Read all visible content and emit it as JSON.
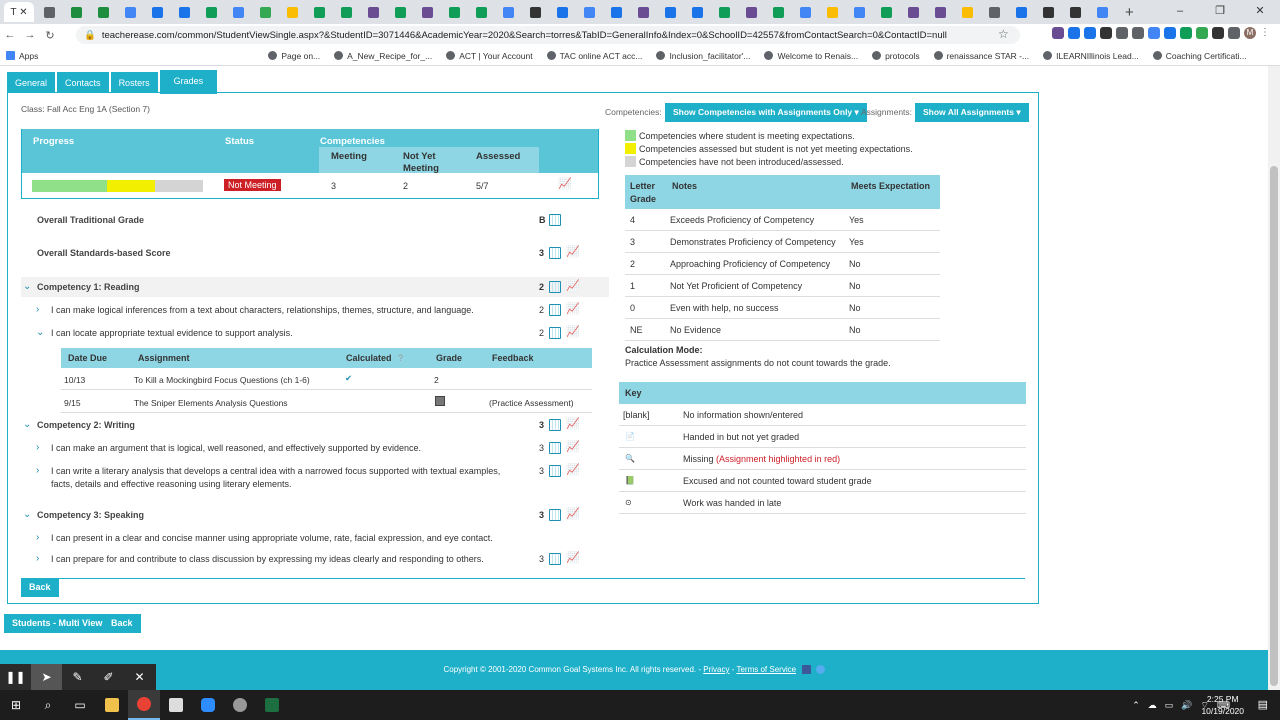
{
  "browser": {
    "active_tab_label": "T",
    "tab_icon_colors": [
      "#5f6368",
      "#1e8e3e",
      "#1e8e3e",
      "#4285f4",
      "#1a73e8",
      "#1a73e8",
      "#0f9d58",
      "#4285f4",
      "#34a853",
      "#fbbc04",
      "#0f9d58",
      "#0f9d58",
      "#6a4c93",
      "#0f9d58",
      "#6a4c93",
      "#0f9d58",
      "#0f9d58",
      "#4285f4",
      "#333",
      "#1a73e8",
      "#4285f4",
      "#1a73e8",
      "#6a4c93",
      "#1a73e8",
      "#1a73e8",
      "#0f9d58",
      "#6a4c93",
      "#0f9d58",
      "#4285f4",
      "#fbbc04",
      "#4285f4",
      "#0f9d58",
      "#6a4c93",
      "#6a4c93",
      "#fbbc04",
      "#5f6368",
      "#1a73e8",
      "#333",
      "#333",
      "#4285f4"
    ],
    "new_tab": "+",
    "window_controls": [
      "–",
      "❐",
      "✕"
    ],
    "url": "teacherease.com/common/StudentViewSingle.aspx?&StudentID=3071446&AcademicYear=2020&Search=torres&TabID=GeneralInfo&Index=0&SchoolID=42557&fromContactSearch=0&ContactID=null",
    "bookmarks": [
      {
        "label": "Apps",
        "blur": false
      },
      {
        "label": "Page on...",
        "blur": false
      },
      {
        "label": "A_New_Recipe_for_...",
        "blur": false
      },
      {
        "label": "ACT | Your Account",
        "blur": false
      },
      {
        "label": "TAC online ACT acc...",
        "blur": false
      },
      {
        "label": "Inclusion_facilitator'...",
        "blur": false
      },
      {
        "label": "Welcome to Renais...",
        "blur": false
      },
      {
        "label": "protocols",
        "blur": false
      },
      {
        "label": "renaissance STAR -...",
        "blur": false
      },
      {
        "label": "ILEARNIllinois Lead...",
        "blur": false
      },
      {
        "label": "Coaching Certificati...",
        "blur": false
      }
    ],
    "profile_initial": "M"
  },
  "tabs": [
    "General",
    "Contacts",
    "Rosters",
    "Grades"
  ],
  "class_label": "Class: Fall Acc Eng 1A (Section 7)",
  "summary": {
    "progress_header": "Progress",
    "status_header": "Status",
    "competencies_header": "Competencies",
    "meeting_header": "Meeting",
    "not_yet_header": "Not Yet Meeting",
    "assessed_header": "Assessed",
    "status_value": "Not Meeting",
    "meeting": "3",
    "not_yet": "2",
    "assessed": "5/7",
    "progress_colors": [
      "#90e08a",
      "#f2ef00",
      "#d4d4d4"
    ]
  },
  "overall": [
    {
      "label": "Overall Traditional Grade",
      "grade": "B"
    },
    {
      "label": "Overall Standards-based Score",
      "grade": "3"
    }
  ],
  "competencies": [
    {
      "title": "Competency 1: Reading",
      "grade": "2",
      "items": [
        {
          "text": "I can make logical inferences from a text about characters, relationships, themes, structure, and language.",
          "grade": "2"
        },
        {
          "text": "I can locate appropriate textual evidence to support analysis.",
          "grade": "2"
        }
      ]
    },
    {
      "title": "Competency 2: Writing",
      "grade": "3",
      "items": [
        {
          "text": "I can make an argument that is logical, well reasoned, and effectively supported by evidence.",
          "grade": "3"
        },
        {
          "text": "I can write a literary analysis that develops a central idea with a narrowed focus supported with textual examples,",
          "text2": "facts, details and effective reasoning using literary elements.",
          "grade": "3"
        }
      ]
    },
    {
      "title": "Competency 3: Speaking",
      "grade": "3",
      "items": [
        {
          "text": "I can present in a clear and concise manner using appropriate volume, rate, facial expression, and eye contact.",
          "grade": ""
        },
        {
          "text": "I can prepare for and contribute to class discussion by expressing my ideas clearly and responding to others.",
          "grade": "3"
        }
      ]
    }
  ],
  "assignments": {
    "headers": [
      "Date Due",
      "Assignment",
      "Calculated",
      "Grade",
      "Feedback"
    ],
    "calculated_help": "?",
    "rows": [
      {
        "date": "10/13",
        "name": "To Kill a Mockingbird Focus Questions (ch 1-6)",
        "calculated": "✔",
        "grade": "2",
        "feedback": ""
      },
      {
        "date": "9/15",
        "name": "The Sniper Elements Analysis Questions",
        "calculated": "",
        "grade": "",
        "feedback": "(Practice Assessment)"
      }
    ]
  },
  "back_label": "Back",
  "right": {
    "competencies_label": "Competencies:",
    "competencies_dropdown": "Show Competencies with Assignments Only ▾",
    "assignments_label": "Assignments:",
    "assignments_dropdown": "Show All Assignments ▾",
    "legend": [
      {
        "color": "#90e08a",
        "text": "Competencies where student is meeting expectations."
      },
      {
        "color": "#f2ef00",
        "text": "Competencies assessed but student is not yet meeting expectations."
      },
      {
        "color": "#d4d4d4",
        "text": "Competencies have not been introduced/assessed."
      }
    ],
    "grade_headers": [
      "Letter",
      "Grade",
      "Notes",
      "Meets Expectation"
    ],
    "grade_rows": [
      {
        "g": "4",
        "notes": "Exceeds Proficiency of Competency",
        "meets": "Yes"
      },
      {
        "g": "3",
        "notes": "Demonstrates Proficiency of Competency",
        "meets": "Yes"
      },
      {
        "g": "2",
        "notes": "Approaching Proficiency of Competency",
        "meets": "No"
      },
      {
        "g": "1",
        "notes": "Not Yet Proficient of Competency",
        "meets": "No"
      },
      {
        "g": "0",
        "notes": "Even with help, no success",
        "meets": "No"
      },
      {
        "g": "NE",
        "notes": "No Evidence",
        "meets": "No"
      }
    ],
    "calc_mode_title": "Calculation Mode:",
    "calc_mode_text": "Practice Assessment assignments do not count towards the grade.",
    "key_title": "Key",
    "key_rows": [
      {
        "sym": "[blank]",
        "text": "No information shown/entered",
        "extra": ""
      },
      {
        "sym": "📄",
        "text": "Handed in but not yet graded",
        "extra": ""
      },
      {
        "sym": "🔍",
        "text": "Missing ",
        "extra": "(Assignment highlighted in red)"
      },
      {
        "sym": "📗",
        "text": "Excused and not counted toward student grade",
        "extra": ""
      },
      {
        "sym": "⊙",
        "text": "Work was handed in late",
        "extra": ""
      }
    ]
  },
  "bottom_buttons": [
    "Students - Multi View",
    "Back"
  ],
  "footer": {
    "copyright": "Copyright © 2001-2020 Common Goal Systems Inc. All rights reserved. - ",
    "privacy": "Privacy",
    "sep": " - ",
    "terms": "Terms of Service"
  },
  "taskbar": {
    "time": "2:25 PM",
    "date": "10/19/2020"
  }
}
